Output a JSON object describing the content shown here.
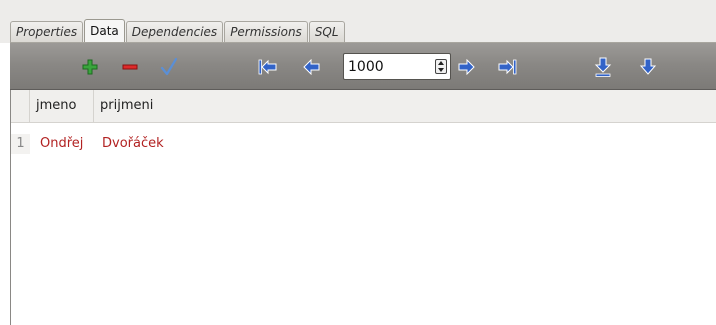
{
  "tabs": [
    {
      "label": "Properties",
      "active": false
    },
    {
      "label": "Data",
      "active": true
    },
    {
      "label": "Dependencies",
      "active": false
    },
    {
      "label": "Permissions",
      "active": false
    },
    {
      "label": "SQL",
      "active": false
    }
  ],
  "toolbar": {
    "icons": [
      "add-row-icon",
      "delete-row-icon",
      "apply-icon",
      "first-page-icon",
      "previous-page-icon",
      "next-page-icon",
      "last-page-icon",
      "download-all-icon",
      "download-icon"
    ],
    "limit_value": "1000",
    "colors": {
      "add": "#39a33c",
      "delete": "#d62020",
      "arrow": "#2f5fc7"
    }
  },
  "grid": {
    "columns": [
      "jmeno",
      "prijmeni"
    ],
    "rows": [
      {
        "num": "1",
        "cells": [
          "Ondřej",
          "Dvořáček"
        ]
      }
    ],
    "value_color": "#b22222"
  }
}
